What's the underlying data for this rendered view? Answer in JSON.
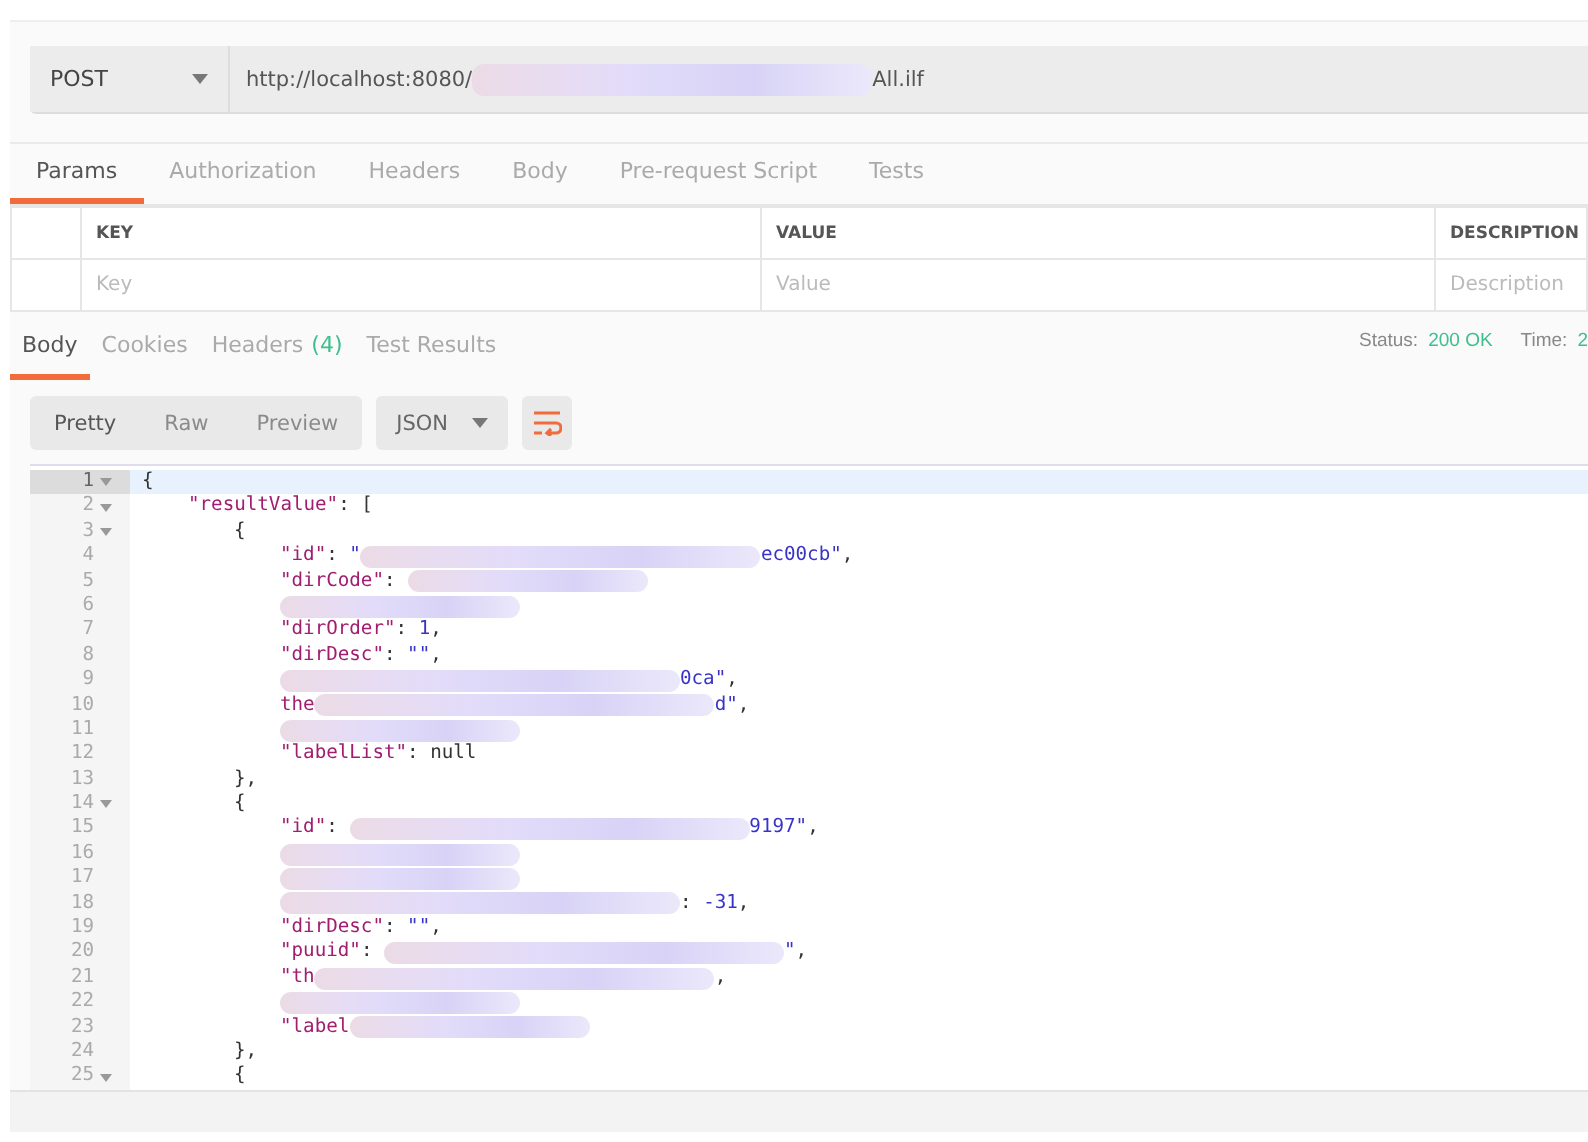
{
  "request": {
    "method": "POST",
    "url": [
      {
        "kind": "text",
        "text": "http://localhost:8080/"
      },
      {
        "kind": "blur"
      },
      {
        "kind": "text",
        "text": "All.ilf"
      }
    ]
  },
  "request_tabs": [
    {
      "label": "Params",
      "selected": true
    },
    {
      "label": "Authorization",
      "selected": false
    },
    {
      "label": "Headers",
      "selected": false
    },
    {
      "label": "Body",
      "selected": false
    },
    {
      "label": "Pre-request Script",
      "selected": false
    },
    {
      "label": "Tests",
      "selected": false
    }
  ],
  "params": {
    "columns": [
      "KEY",
      "VALUE",
      "DESCRIPTION"
    ],
    "placeholders": [
      "Key",
      "Value",
      "Description"
    ]
  },
  "response_tabs": [
    {
      "label": "Body",
      "selected": true
    },
    {
      "label": "Cookies",
      "selected": false
    },
    {
      "label": "Headers",
      "count": "(4)",
      "selected": false
    },
    {
      "label": "Test Results",
      "selected": false
    }
  ],
  "response_status": {
    "status_label": "Status:",
    "status": "200 OK",
    "time_label": "Time:",
    "time": "2"
  },
  "view_modes": [
    {
      "label": "Pretty",
      "selected": true
    },
    {
      "label": "Raw",
      "selected": false
    },
    {
      "label": "Preview",
      "selected": false
    }
  ],
  "format": "JSON",
  "code_lines": [
    {
      "number": "1",
      "foldable": true,
      "active": true,
      "segments": [
        {
          "kind": "plain",
          "text": "{"
        }
      ]
    },
    {
      "number": "2",
      "foldable": true,
      "active": false,
      "segments": [
        {
          "kind": "key",
          "text": "\"resultValue\""
        },
        {
          "kind": "plain",
          "text": ": ["
        }
      ]
    },
    {
      "number": "3",
      "foldable": true,
      "active": false,
      "segments": [
        {
          "kind": "plain",
          "text": "{"
        }
      ]
    },
    {
      "number": "4",
      "foldable": false,
      "active": false,
      "segments": [
        {
          "kind": "key",
          "text": "\"id\""
        },
        {
          "kind": "plain",
          "text": ": "
        },
        {
          "kind": "string",
          "text": "\""
        },
        {
          "kind": "blur"
        },
        {
          "kind": "string",
          "text": "ec00cb\""
        },
        {
          "kind": "plain",
          "text": ","
        }
      ]
    },
    {
      "number": "5",
      "foldable": false,
      "active": false,
      "segments": [
        {
          "kind": "key",
          "text": "\"dirCode\""
        },
        {
          "kind": "plain",
          "text": ": "
        },
        {
          "kind": "blur"
        }
      ]
    },
    {
      "number": "6",
      "foldable": false,
      "active": false,
      "segments": [
        {
          "kind": "blur"
        }
      ]
    },
    {
      "number": "7",
      "foldable": false,
      "active": false,
      "segments": [
        {
          "kind": "key",
          "text": "\"dirOrder\""
        },
        {
          "kind": "plain",
          "text": ": "
        },
        {
          "kind": "number",
          "text": "1"
        },
        {
          "kind": "plain",
          "text": ","
        }
      ]
    },
    {
      "number": "8",
      "foldable": false,
      "active": false,
      "segments": [
        {
          "kind": "key",
          "text": "\"dirDesc\""
        },
        {
          "kind": "plain",
          "text": ": "
        },
        {
          "kind": "string",
          "text": "\"\""
        },
        {
          "kind": "plain",
          "text": ","
        }
      ]
    },
    {
      "number": "9",
      "foldable": false,
      "active": false,
      "segments": [
        {
          "kind": "blur"
        },
        {
          "kind": "string",
          "text": "0ca\""
        },
        {
          "kind": "plain",
          "text": ","
        }
      ]
    },
    {
      "number": "10",
      "foldable": false,
      "active": false,
      "segments": [
        {
          "kind": "key",
          "text": "the"
        },
        {
          "kind": "blur"
        },
        {
          "kind": "string",
          "text": "d\""
        },
        {
          "kind": "plain",
          "text": ","
        }
      ]
    },
    {
      "number": "11",
      "foldable": false,
      "active": false,
      "segments": [
        {
          "kind": "blur"
        }
      ]
    },
    {
      "number": "12",
      "foldable": false,
      "active": false,
      "segments": [
        {
          "kind": "key",
          "text": "\"labelList\""
        },
        {
          "kind": "plain",
          "text": ": null"
        }
      ]
    },
    {
      "number": "13",
      "foldable": false,
      "active": false,
      "segments": [
        {
          "kind": "plain",
          "text": "},"
        }
      ]
    },
    {
      "number": "14",
      "foldable": true,
      "active": false,
      "segments": [
        {
          "kind": "plain",
          "text": "{"
        }
      ]
    },
    {
      "number": "15",
      "foldable": false,
      "active": false,
      "segments": [
        {
          "kind": "key",
          "text": "\"id\""
        },
        {
          "kind": "plain",
          "text": ": "
        },
        {
          "kind": "blur"
        },
        {
          "kind": "string",
          "text": "9197\""
        },
        {
          "kind": "plain",
          "text": ","
        }
      ]
    },
    {
      "number": "16",
      "foldable": false,
      "active": false,
      "segments": [
        {
          "kind": "blur"
        }
      ]
    },
    {
      "number": "17",
      "foldable": false,
      "active": false,
      "segments": [
        {
          "kind": "blur"
        }
      ]
    },
    {
      "number": "18",
      "foldable": false,
      "active": false,
      "segments": [
        {
          "kind": "blur"
        },
        {
          "kind": "plain",
          "text": ": "
        },
        {
          "kind": "number",
          "text": "-31"
        },
        {
          "kind": "plain",
          "text": ","
        }
      ]
    },
    {
      "number": "19",
      "foldable": false,
      "active": false,
      "segments": [
        {
          "kind": "key",
          "text": "\"dirDesc\""
        },
        {
          "kind": "plain",
          "text": ": "
        },
        {
          "kind": "string",
          "text": "\"\""
        },
        {
          "kind": "plain",
          "text": ","
        }
      ]
    },
    {
      "number": "20",
      "foldable": false,
      "active": false,
      "segments": [
        {
          "kind": "key",
          "text": "\"puuid\""
        },
        {
          "kind": "plain",
          "text": ": "
        },
        {
          "kind": "blur"
        },
        {
          "kind": "string",
          "text": "\""
        },
        {
          "kind": "plain",
          "text": ","
        }
      ]
    },
    {
      "number": "21",
      "foldable": false,
      "active": false,
      "segments": [
        {
          "kind": "key",
          "text": "\"th"
        },
        {
          "kind": "blur"
        },
        {
          "kind": "plain",
          "text": ","
        }
      ]
    },
    {
      "number": "22",
      "foldable": false,
      "active": false,
      "segments": [
        {
          "kind": "blur"
        }
      ]
    },
    {
      "number": "23",
      "foldable": false,
      "active": false,
      "segments": [
        {
          "kind": "key",
          "text": "\"label"
        },
        {
          "kind": "blur"
        }
      ]
    },
    {
      "number": "24",
      "foldable": false,
      "active": false,
      "segments": [
        {
          "kind": "plain",
          "text": "},"
        }
      ]
    },
    {
      "number": "25",
      "foldable": true,
      "active": false,
      "segments": [
        {
          "kind": "plain",
          "text": "{"
        }
      ]
    }
  ]
}
